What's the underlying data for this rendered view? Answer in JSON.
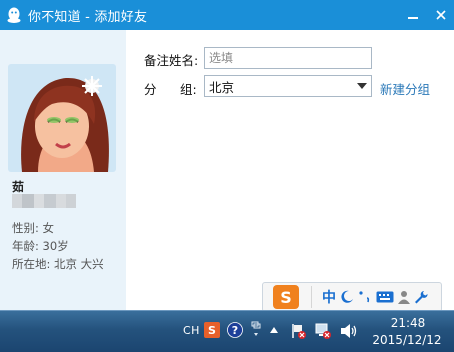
{
  "window": {
    "title": "你不知道 - 添加好友"
  },
  "profile": {
    "nickname": "茹",
    "gender": "性别: 女",
    "age": "年龄: 30岁",
    "location": "所在地: 北京  大兴"
  },
  "form": {
    "remark_label": "备注姓名:",
    "remark_placeholder": "选填",
    "group_label_1": "分",
    "group_label_2": "组:",
    "group_value": "北京",
    "new_group_link": "新建分组"
  },
  "ime": {
    "logo_text": "S",
    "lang_label": "中",
    "icons": [
      "moon-icon",
      "punctuation-icon",
      "keyboard-icon",
      "user-icon",
      "wrench-icon"
    ]
  },
  "taskbar": {
    "lang": "CH",
    "time": "21:48",
    "date": "2015/12/12"
  },
  "colors": {
    "titlebar": "#1a8fd8",
    "left_panel": "#e9f3fa",
    "link": "#2a78b8",
    "ime_orange": "#f0811e",
    "taskbar": "#24527d"
  }
}
